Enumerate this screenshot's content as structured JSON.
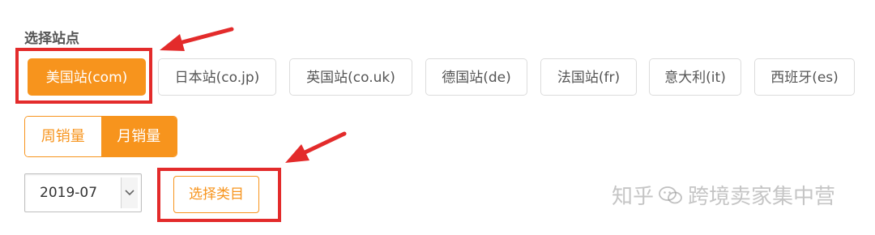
{
  "section_title": "选择站点",
  "sites": [
    {
      "label": "美国站(com)",
      "active": true
    },
    {
      "label": "日本站(co.jp)",
      "active": false
    },
    {
      "label": "英国站(co.uk)",
      "active": false
    },
    {
      "label": "德国站(de)",
      "active": false
    },
    {
      "label": "法国站(fr)",
      "active": false
    },
    {
      "label": "意大利(it)",
      "active": false
    },
    {
      "label": "西班牙(es)",
      "active": false
    }
  ],
  "sales_toggle": {
    "weekly": "周销量",
    "monthly": "月销量",
    "selected": "monthly"
  },
  "month_select": {
    "value": "2019-07"
  },
  "category_button": "选择类目",
  "watermark": {
    "prefix": "知乎",
    "name": "跨境卖家集中营"
  },
  "colors": {
    "accent": "#f7941d",
    "annotation": "#e32b2b"
  },
  "icons": {
    "select_arrow": "chevron-down-icon",
    "watermark_icon": "wechat-icon"
  }
}
